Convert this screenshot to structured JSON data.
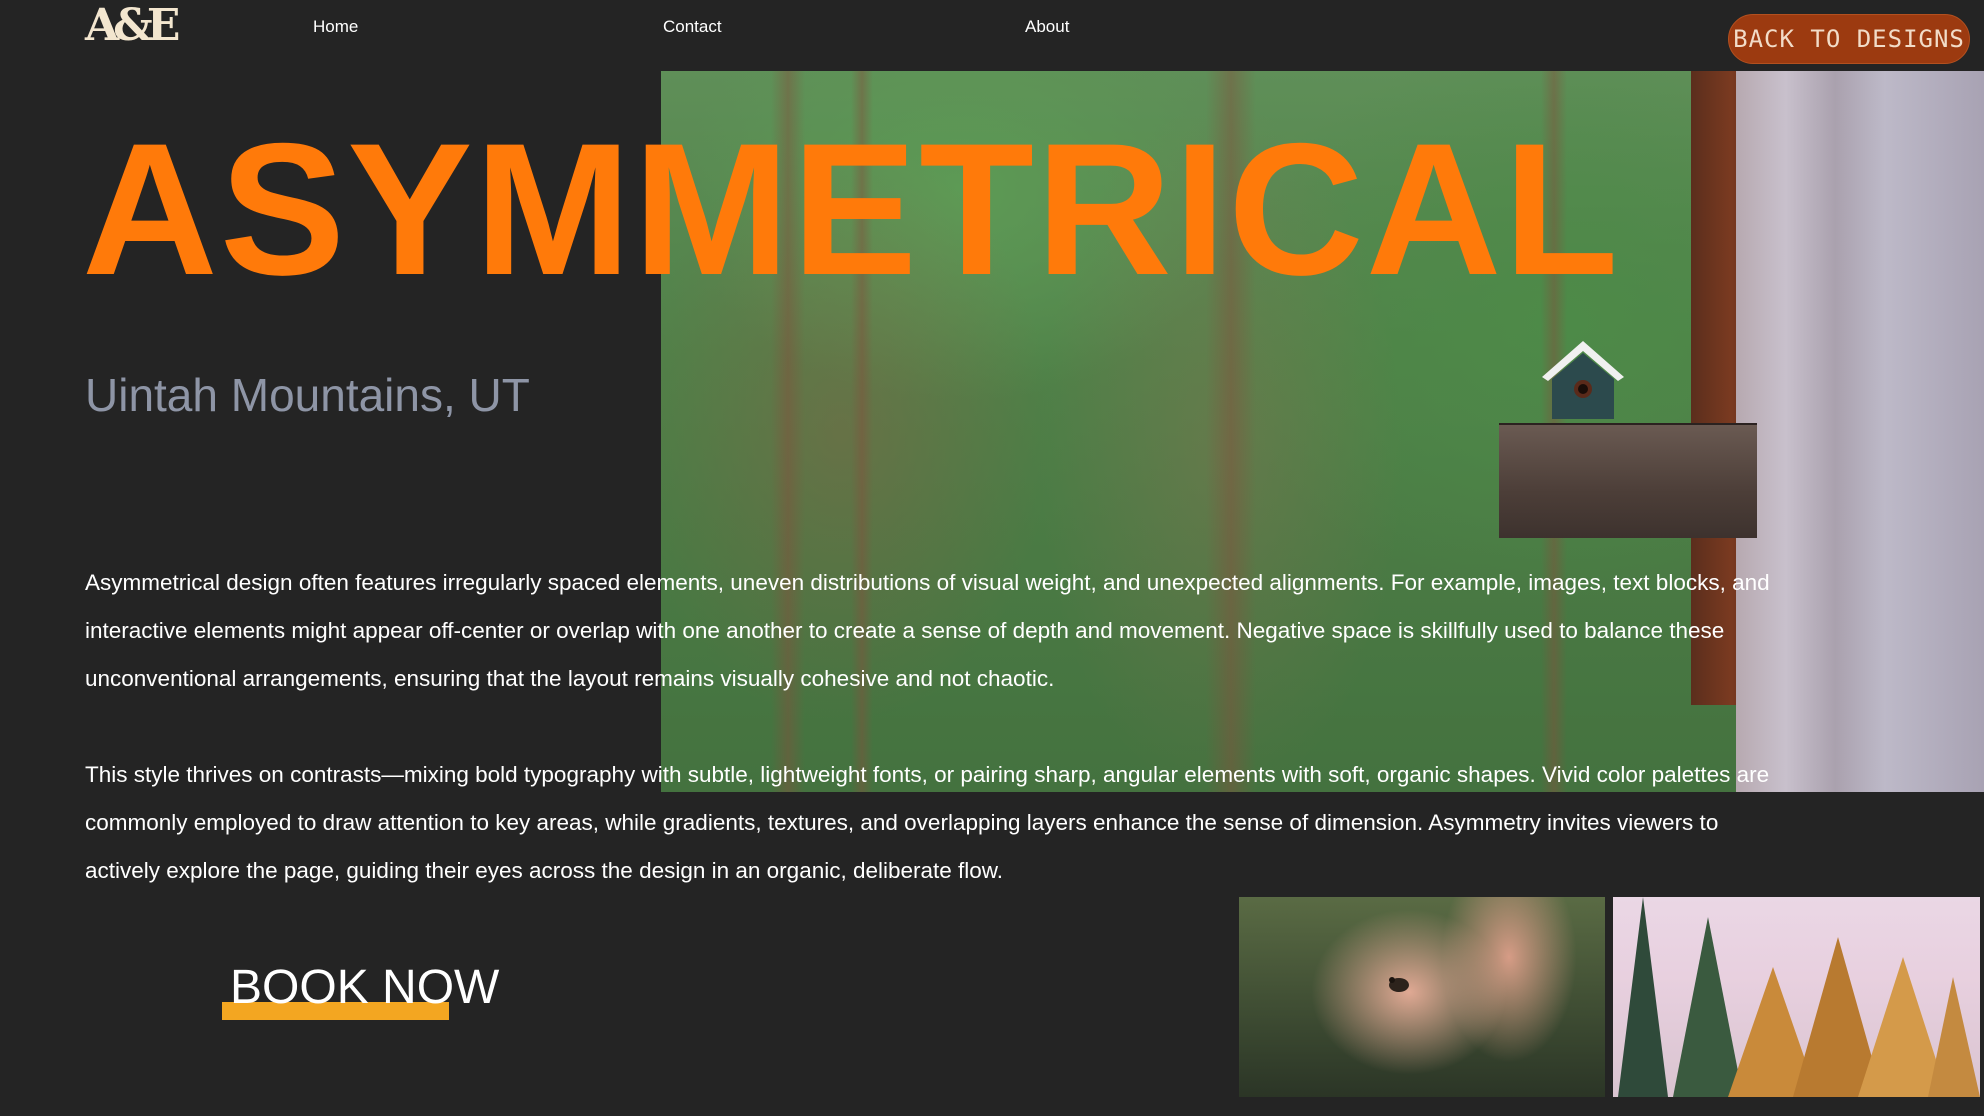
{
  "nav": {
    "logo": "A&E",
    "links": [
      "Home",
      "Contact",
      "About"
    ],
    "back_button": "Back to Designs"
  },
  "hero": {
    "title": "ASYMMETRICAL",
    "subtitle": "Uintah Mountains, UT",
    "image": "forest-birdhouse-photo"
  },
  "body": {
    "paragraph1": "Asymmetrical design often features irregularly spaced elements, uneven distributions of visual weight, and unexpected alignments. For example, images, text blocks, and interactive elements might appear off-center or overlap with one another to create a sense of depth and movement. Negative space is skillfully used to balance these unconventional arrangements, ensuring that the layout remains visually cohesive and not chaotic.",
    "paragraph2": "This style thrives on contrasts—mixing bold typography with subtle, lightweight fonts, or pairing sharp, angular elements with soft, organic shapes. Vivid color palettes are commonly employed to draw attention to key areas, while gradients, textures, and overlapping layers enhance the sense of dimension. Asymmetry invites viewers to actively explore the page, guiding their eyes across the design in an organic, deliberate flow."
  },
  "cta": {
    "label": "BOOK NOW"
  },
  "gallery": [
    "hands-holding-frog-photo",
    "pine-trees-photo"
  ],
  "colors": {
    "background": "#242424",
    "accent_orange": "#ff7a0a",
    "button_brown": "#9c3a10",
    "underline_yellow": "#f3a621",
    "subtitle_gray": "#8e95a6"
  }
}
